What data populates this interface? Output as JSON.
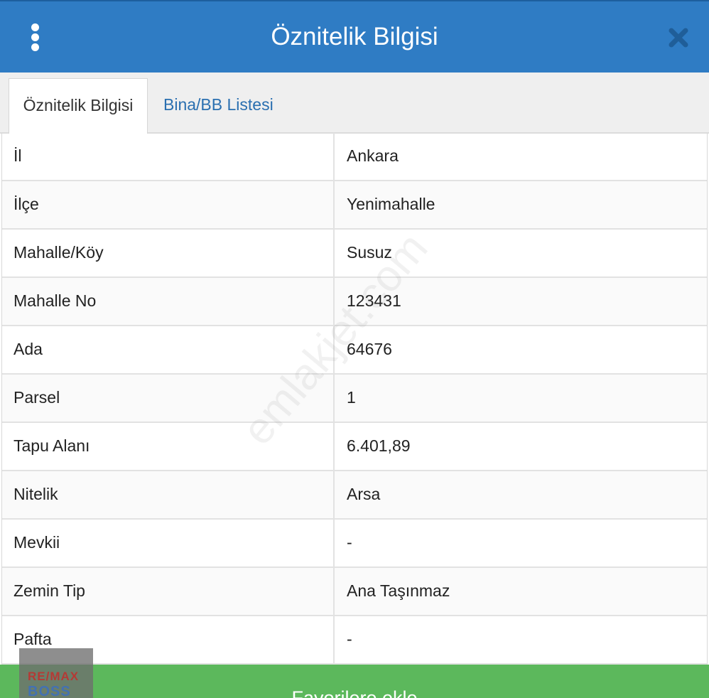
{
  "header": {
    "title": "Öznitelik Bilgisi",
    "menu_icon": "kebab-menu-icon",
    "close_icon": "close-icon"
  },
  "tabs": [
    {
      "label": "Öznitelik Bilgisi",
      "active": true
    },
    {
      "label": "Bina/BB Listesi",
      "active": false
    }
  ],
  "rows": [
    {
      "key": "İl",
      "value": "Ankara"
    },
    {
      "key": "İlçe",
      "value": "Yenimahalle"
    },
    {
      "key": "Mahalle/Köy",
      "value": "Susuz"
    },
    {
      "key": "Mahalle No",
      "value": "123431"
    },
    {
      "key": "Ada",
      "value": "64676"
    },
    {
      "key": "Parsel",
      "value": "1"
    },
    {
      "key": "Tapu Alanı",
      "value": "6.401,89"
    },
    {
      "key": "Nitelik",
      "value": "Arsa"
    },
    {
      "key": "Mevkii",
      "value": "-"
    },
    {
      "key": "Zemin Tip",
      "value": "Ana Taşınmaz"
    },
    {
      "key": "Pafta",
      "value": "-"
    }
  ],
  "watermark": {
    "text": "emlakjet.com"
  },
  "footer": {
    "button_label": "Favorilere ekle"
  },
  "badge": {
    "brand": "RE/MAX",
    "sub": "BOSS"
  },
  "colors": {
    "header_bg": "#2f7cc4",
    "tab_link": "#2a6fb0",
    "footer_bg": "#5cb85c"
  }
}
